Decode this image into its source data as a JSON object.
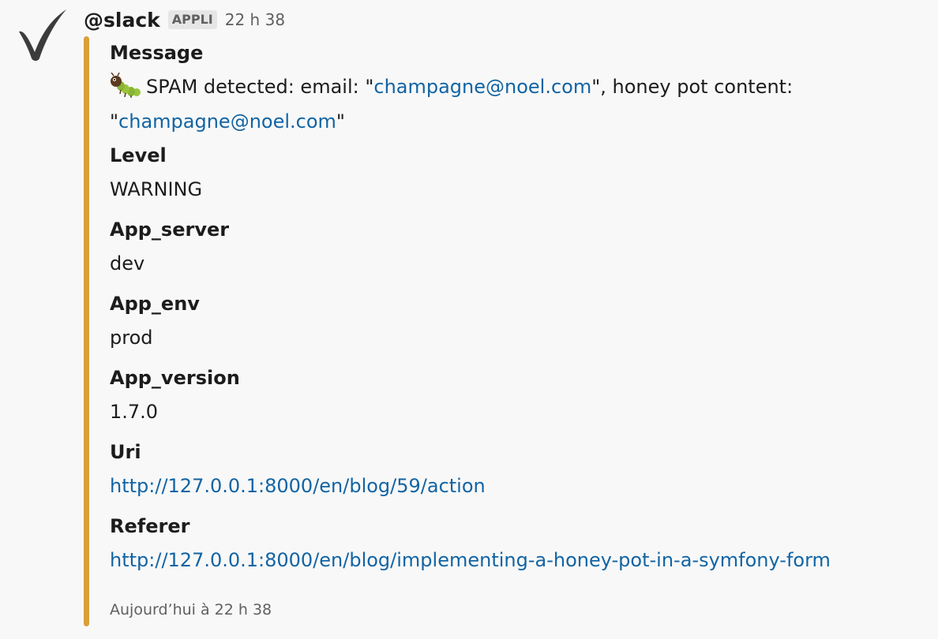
{
  "header": {
    "sender": "@slack",
    "badge": "APPLI",
    "time": "22 h 38"
  },
  "avatar": {
    "icon": "checkmark-icon",
    "color": "#3c3c3c"
  },
  "attachment": {
    "color": "#daa038",
    "fields": {
      "message": {
        "title": "Message",
        "icon": "bug-icon",
        "text_1": "SPAM detected: email: \"",
        "link_1": "champagne@noel.com",
        "text_2": "\", honey pot content: \"",
        "link_2": "champagne@noel.com",
        "text_3": "\""
      },
      "level": {
        "title": "Level",
        "value": "WARNING"
      },
      "app_server": {
        "title": "App_server",
        "value": "dev"
      },
      "app_env": {
        "title": "App_env",
        "value": "prod"
      },
      "app_version": {
        "title": "App_version",
        "value": "1.7.0"
      },
      "uri": {
        "title": "Uri",
        "value": "http://127.0.0.1:8000/en/blog/59/action"
      },
      "referer": {
        "title": "Referer",
        "value": "http://127.0.0.1:8000/en/blog/implementing-a-honey-pot-in-a-symfony-form"
      }
    },
    "footer": "Aujourd’hui à 22 h 38"
  },
  "colors": {
    "link": "#1264a3",
    "muted": "#616061",
    "background": "#f8f8f8"
  }
}
